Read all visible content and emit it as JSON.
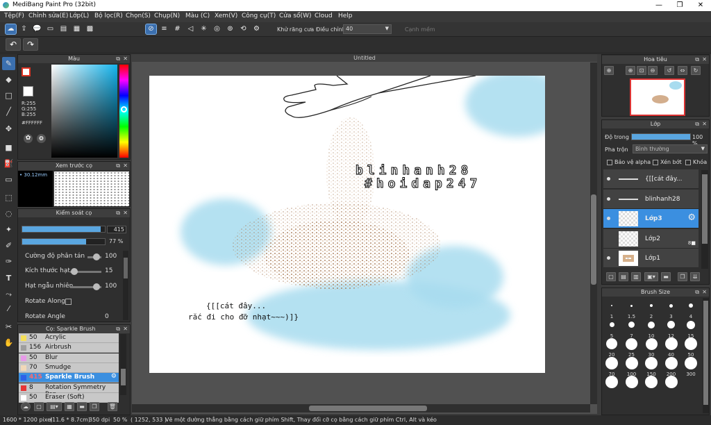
{
  "window": {
    "title": "MediBang Paint Pro (32bit)"
  },
  "menu": [
    "Tệp(F)",
    "Chỉnh sửa(E)",
    "Lớp(L)",
    "Bộ lọc(R)",
    "Chọn(S)",
    "Chụp(N)",
    "Màu (C)",
    "Xem(V)",
    "Công cụ(T)",
    "Cửa sổ(W)",
    "Cloud",
    "Help"
  ],
  "toolbar": {
    "antialias_label": "Khử răng cưa",
    "adjust_label": "Điều chỉnh",
    "adjust_value": "40",
    "edge_label": "Cạnh mềm"
  },
  "canvas": {
    "doc_title": "Untitled",
    "text1": "blinhanh28",
    "text2": "#hoidap247",
    "text3": "{[[cát đây...",
    "text4": "rắc đi cho đỡ nhạt~~~)]}"
  },
  "color_panel": {
    "title": "Màu",
    "r": "R:255",
    "g": "G:255",
    "b": "B:255",
    "hex": "#FFFFFF"
  },
  "preview_panel": {
    "title": "Xem trước cọ",
    "size": "30.12mm"
  },
  "brush_control": {
    "title": "Kiểm soát cọ",
    "size_value": "415",
    "opacity_value": "77 %",
    "size_fraction": 0.95,
    "opacity_fraction": 0.77,
    "rows": [
      {
        "label": "Cường độ phân tán",
        "value": "100"
      },
      {
        "label": "Kích thước hạt",
        "value": "15"
      },
      {
        "label": "Hạt ngẫu nhiên",
        "value": "100"
      },
      {
        "label": "Rotate Along",
        "value": ""
      },
      {
        "label": "Rotate Angle",
        "value": "0"
      }
    ]
  },
  "brush_list": {
    "title": "Cọ: Sparkle Brush",
    "items": [
      {
        "size": "50",
        "name": "Acrylic",
        "color": "#f5e05a"
      },
      {
        "size": "156",
        "name": "Airbrush",
        "color": "#9e9e9e"
      },
      {
        "size": "50",
        "name": "Blur",
        "color": "#e79ae8"
      },
      {
        "size": "70",
        "name": "Smudge",
        "color": "#f1d8b8"
      },
      {
        "size": "415",
        "name": "Sparkle Brush",
        "color": "#2f62e8"
      },
      {
        "size": "8",
        "name": "Rotation Symmetry Pen",
        "color": "#e83535"
      },
      {
        "size": "50",
        "name": "Eraser (Soft)",
        "color": "#ffffff"
      }
    ]
  },
  "navigator": {
    "title": "Hoa tiêu"
  },
  "layer_panel": {
    "title": "Lớp",
    "opacity_label": "Độ trong",
    "opacity_value": "100 %",
    "opacity_fraction": 1.0,
    "blend_label": "Pha trộn",
    "blend_value": "Bình thường",
    "protect_alpha": "Bảo vệ alpha",
    "clipping": "Xén bớt",
    "lock": "Khóa",
    "layers": [
      {
        "name": "{[[cát đây..."
      },
      {
        "name": "blinhanh28"
      },
      {
        "name": "Lớp3"
      },
      {
        "name": "Lớp2"
      },
      {
        "name": "Lớp1"
      }
    ]
  },
  "brush_size": {
    "title": "Brush Size",
    "sizes": [
      "1",
      "1.5",
      "2",
      "3",
      "4",
      "5",
      "7",
      "10",
      "12",
      "15",
      "20",
      "25",
      "30",
      "40",
      "50",
      "70",
      "100",
      "150",
      "200",
      "300",
      "",
      "",
      "",
      ""
    ]
  },
  "status": {
    "dimensions": "1600 * 1200 pixel",
    "cm": "(11.6 * 8.7cm)",
    "dpi": "350 dpi",
    "zoom": "50 %",
    "coords": "( 1252, 533 )",
    "hint": "Vẽ một đường thẳng bằng cách giữ phím Shift, Thay đổi cỡ cọ bằng cách giữ phím Ctrl, Alt và kéo"
  }
}
